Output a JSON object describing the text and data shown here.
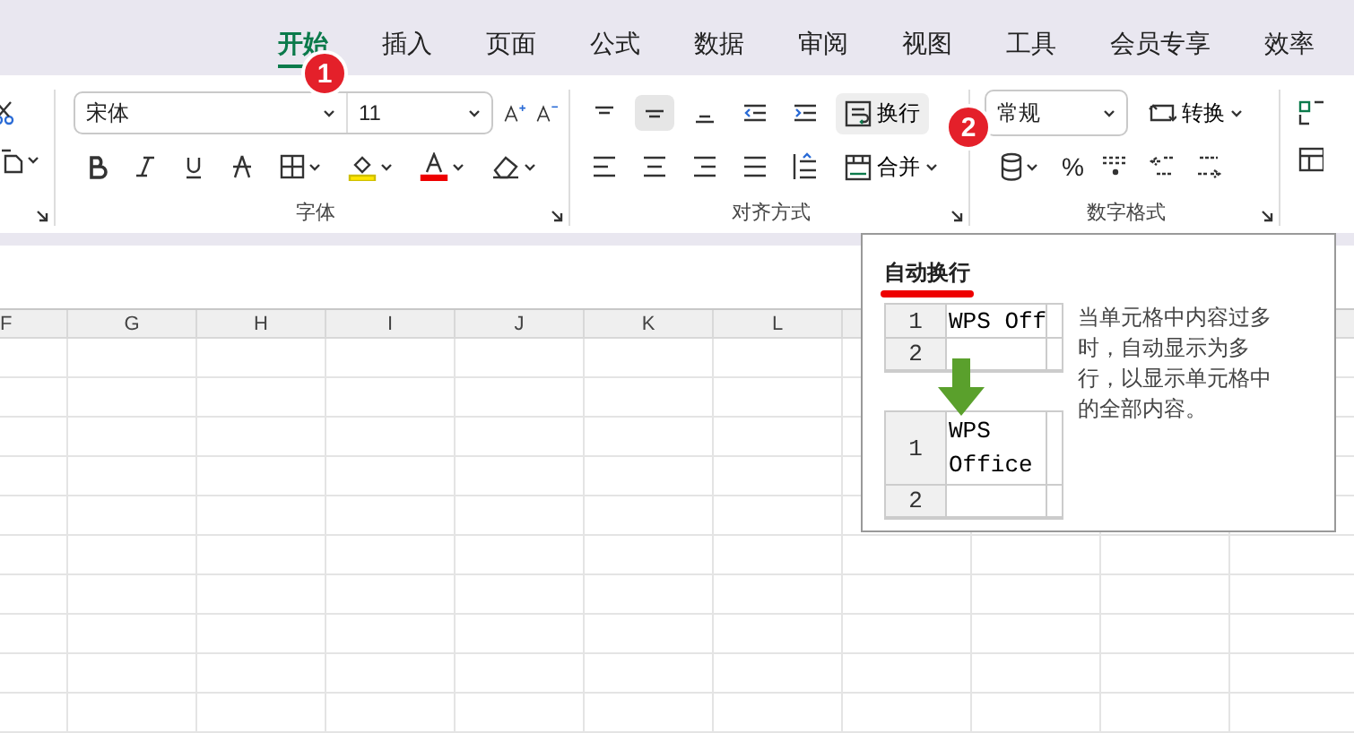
{
  "tabs": [
    {
      "label": "开始",
      "selected": true
    },
    {
      "label": "插入",
      "selected": false
    },
    {
      "label": "页面",
      "selected": false
    },
    {
      "label": "公式",
      "selected": false
    },
    {
      "label": "数据",
      "selected": false
    },
    {
      "label": "审阅",
      "selected": false
    },
    {
      "label": "视图",
      "selected": false
    },
    {
      "label": "工具",
      "selected": false
    },
    {
      "label": "会员专享",
      "selected": false
    },
    {
      "label": "效率",
      "selected": false
    }
  ],
  "font_group": {
    "font_name": "宋体",
    "font_size": "11",
    "label": "字体"
  },
  "align_group": {
    "top_row": [
      {
        "selected": false
      },
      {
        "selected": true
      },
      {
        "selected": false
      },
      {
        "selected": false
      },
      {
        "selected": false
      }
    ],
    "wrap_button": {
      "label": "换行",
      "selected": true
    },
    "merge_button": {
      "label": "合并"
    },
    "label": "对齐方式"
  },
  "number_group": {
    "format": "常规",
    "convert": "转换",
    "percent": "%",
    "label": "数字格式"
  },
  "badges": [
    "1",
    "2"
  ],
  "columns": [
    "F",
    "G",
    "H",
    "I",
    "J",
    "K",
    "L"
  ],
  "tooltip": {
    "title": "自动换行",
    "before_rows": [
      {
        "number": "1",
        "text": "WPS Off"
      },
      {
        "number": "2"
      }
    ],
    "after_rows": [
      {
        "number": "1",
        "text": "WPS\nOffice"
      },
      {
        "number": "2"
      }
    ],
    "description": "当单元格中内容过多时，自动显示为多行，以显示单元格中的全部内容。"
  }
}
